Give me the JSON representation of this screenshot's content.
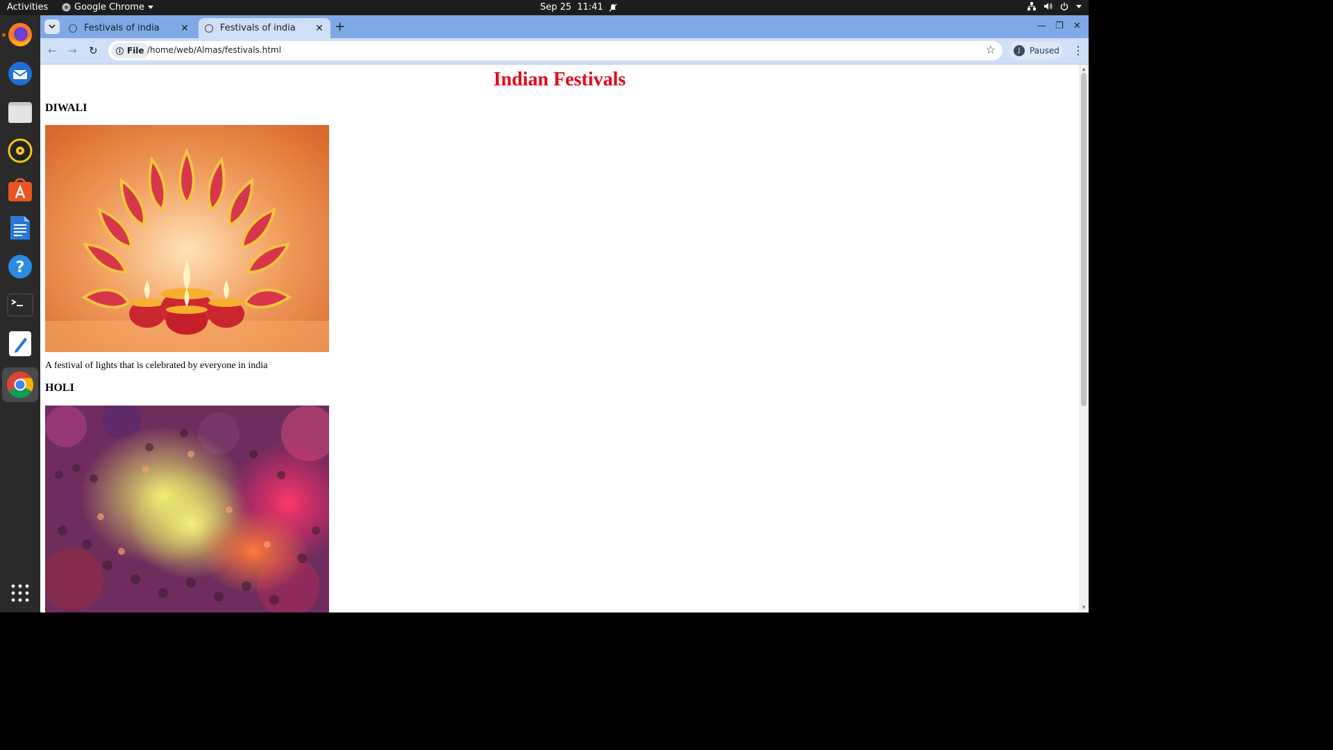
{
  "topbar": {
    "activities": "Activities",
    "app_name": "Google Chrome",
    "date": "Sep 25",
    "time": "11:41"
  },
  "dock": {
    "items": [
      "firefox",
      "thunderbird",
      "files",
      "rhythmbox",
      "app-center",
      "writer",
      "help",
      "terminal",
      "text-editor",
      "chrome",
      "show-apps"
    ]
  },
  "browser": {
    "tabs": [
      {
        "title": "Festivals of india",
        "active": false
      },
      {
        "title": "Festivals of india",
        "active": true
      }
    ],
    "url_chip": "File",
    "url": "/home/web/Almas/festivals.html",
    "profile_initial": "J",
    "profile_status": "Paused"
  },
  "page": {
    "title": "Indian Festivals",
    "festivals": [
      {
        "name": "DIWALI",
        "description": "A festival of lights that is celebrated by everyone in india"
      },
      {
        "name": "HOLI"
      }
    ]
  },
  "colors": {
    "title": "#e5061c",
    "tabstrip": "#7fa9e6",
    "toolbar": "#cfdff7"
  }
}
